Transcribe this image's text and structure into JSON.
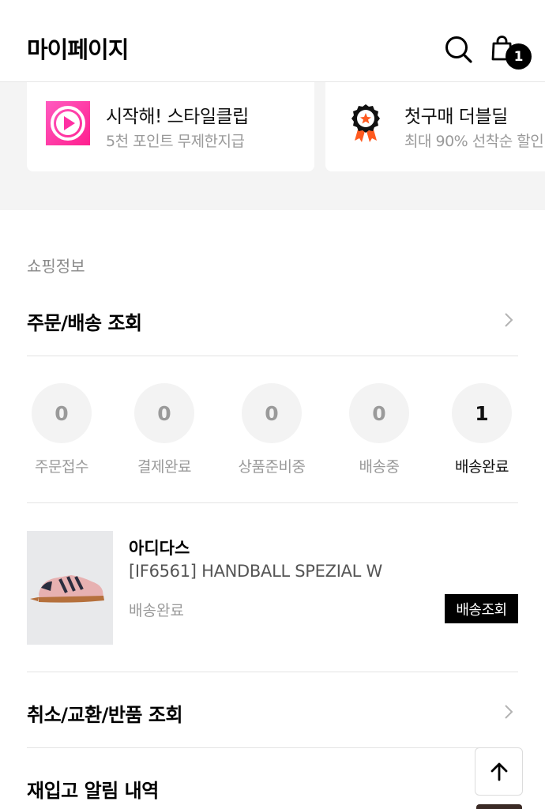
{
  "header": {
    "title": "마이페이지",
    "search_icon": "search-icon",
    "cart_icon": "shopping-bag-icon",
    "cart_count": "1"
  },
  "banners": [
    {
      "title": "시작해! 스타일클립",
      "subtitle": "5천 포인트 무제한지급",
      "icon": "play-circle-icon",
      "accent": "#ff2fa3"
    },
    {
      "title": "첫구매 더블딜",
      "subtitle": "최대 90% 선착순 할인",
      "icon": "award-badge-icon",
      "accent": "#ff5a1f"
    }
  ],
  "shopping": {
    "section_label": "쇼핑정보",
    "order_tracking_label": "주문/배송 조회",
    "statuses": [
      {
        "count": "0",
        "label": "주문접수"
      },
      {
        "count": "0",
        "label": "결제완료"
      },
      {
        "count": "0",
        "label": "상품준비중"
      },
      {
        "count": "0",
        "label": "배송중"
      },
      {
        "count": "1",
        "label": "배송완료"
      }
    ],
    "order": {
      "brand": "아디다스",
      "product_name": "[IF6561] HANDBALL SPEZIAL W",
      "status": "배송완료",
      "track_button": "배송조회"
    },
    "cancel_exchange_label": "취소/교환/반품 조회",
    "restock_label": "재입고 알림 내역"
  },
  "scroll_top_icon": "arrow-up-icon"
}
